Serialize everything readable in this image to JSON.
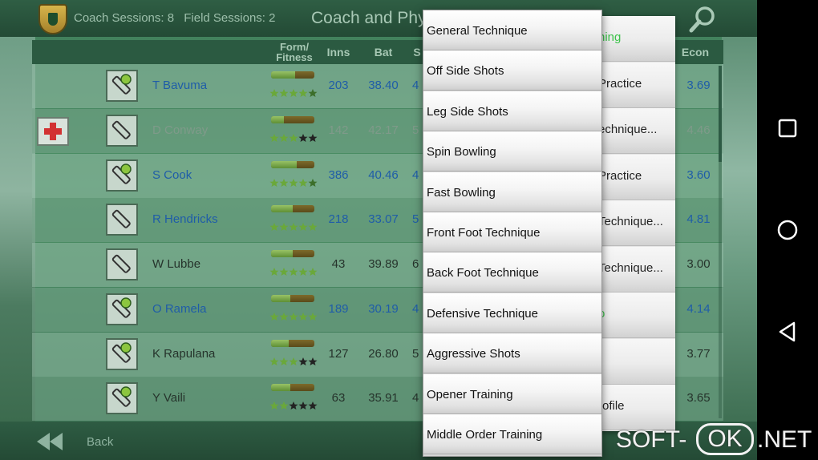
{
  "header": {
    "coach_sessions": "Coach Sessions: 8",
    "field_sessions": "Field Sessions: 2",
    "title": "Coach and Phy"
  },
  "table": {
    "columns": {
      "form": "Form/\nFitness",
      "inns": "Inns",
      "bat": "Bat",
      "s": "S",
      "econ": "Econ"
    },
    "rows": [
      {
        "name": "T Bavuma",
        "inns": "203",
        "bat": "38.40",
        "s": "4",
        "econ": "3.69",
        "form": 0.55,
        "stars": 4.5,
        "role": "batting-keeper",
        "injured": false,
        "color": "blue"
      },
      {
        "name": "D Conway",
        "inns": "142",
        "bat": "42.17",
        "s": "5",
        "econ": "4.46",
        "form": 0.3,
        "stars": 3,
        "role": "batsman",
        "injured": true,
        "color": "muted"
      },
      {
        "name": "S Cook",
        "inns": "386",
        "bat": "40.46",
        "s": "4",
        "econ": "3.60",
        "form": 0.6,
        "stars": 4.5,
        "role": "batting-keeper",
        "injured": false,
        "color": "blue"
      },
      {
        "name": "R Hendricks",
        "inns": "218",
        "bat": "33.07",
        "s": "5",
        "econ": "4.81",
        "form": 0.5,
        "stars": 5,
        "role": "batsman",
        "injured": false,
        "color": "blue"
      },
      {
        "name": "W Lubbe",
        "inns": "43",
        "bat": "39.89",
        "s": "6",
        "econ": "3.00",
        "form": 0.5,
        "stars": 5,
        "role": "batsman",
        "injured": false,
        "color": "dark"
      },
      {
        "name": "O Ramela",
        "inns": "189",
        "bat": "30.19",
        "s": "4",
        "econ": "4.14",
        "form": 0.45,
        "stars": 5,
        "role": "batting-keeper",
        "injured": false,
        "color": "blue"
      },
      {
        "name": "K Rapulana",
        "inns": "127",
        "bat": "26.80",
        "s": "5",
        "econ": "3.77",
        "form": 0.4,
        "stars": 3,
        "role": "batting-keeper",
        "injured": false,
        "color": "dark"
      },
      {
        "name": "Y Vaili",
        "inns": "63",
        "bat": "35.91",
        "s": "4",
        "econ": "3.65",
        "form": 0.45,
        "stars": 2,
        "role": "batting-keeper",
        "injured": false,
        "color": "dark"
      }
    ]
  },
  "footer": {
    "back_label": "Back"
  },
  "secondary_menu": {
    "items": [
      {
        "label": "ning",
        "green": true
      },
      {
        "label": "Practice",
        "green": false
      },
      {
        "label": "echnique...",
        "green": false
      },
      {
        "label": "Practice",
        "green": false
      },
      {
        "label": "Technique...",
        "green": false
      },
      {
        "label": "Technique...",
        "green": false
      },
      {
        "label": "o",
        "green": true
      },
      {
        "label": "",
        "green": false
      },
      {
        "label": "rofile",
        "green": false
      }
    ]
  },
  "dropdown": {
    "items": [
      "General Technique",
      "Off Side Shots",
      "Leg Side Shots",
      "Spin Bowling",
      "Fast Bowling",
      "Front Foot Technique",
      "Back Foot Technique",
      "Defensive Technique",
      "Aggressive Shots",
      "Opener Training",
      "Middle Order Training"
    ]
  },
  "watermark": {
    "left": "SOFT-",
    "box": "OK",
    "right": ".NET"
  },
  "nav": {
    "icons": [
      "recents-icon",
      "home-icon",
      "back-icon"
    ]
  },
  "colors": {
    "accent_green": "#3cc24a",
    "link_blue": "#1f5da8",
    "header_green": "#2b5a41"
  }
}
